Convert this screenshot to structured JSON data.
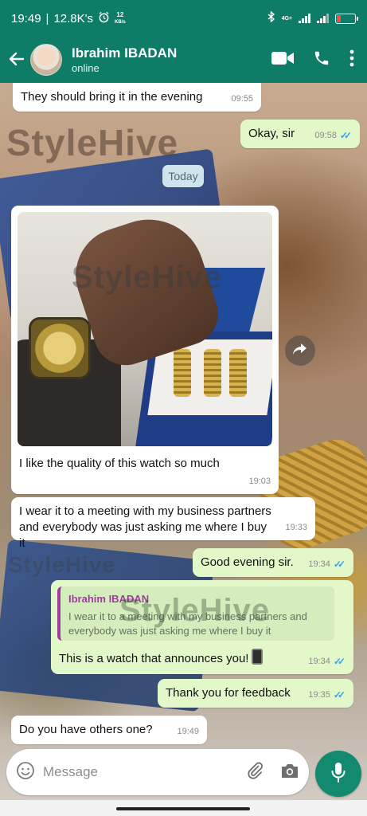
{
  "status_bar": {
    "time": "19:49",
    "net_speed": "12.8K's",
    "speed_num": "12",
    "speed_unit": "KB/s",
    "network_label": "4G+"
  },
  "header": {
    "contact_name": "Ibrahim IBADAN",
    "contact_status": "online"
  },
  "watermark": "StyleHive",
  "date_divider": "Today",
  "messages": [
    {
      "text": "They should bring it in the evening",
      "time": "09:55",
      "direction": "incoming"
    },
    {
      "text": "Okay, sir",
      "time": "09:58",
      "direction": "outgoing",
      "read": true
    },
    {
      "text": "I like the quality of this watch so much",
      "time": "19:03",
      "direction": "incoming",
      "has_image": true
    },
    {
      "text": "I wear it to a meeting with my business partners and everybody was just asking me where I buy it",
      "time": "19:33",
      "direction": "incoming"
    },
    {
      "text": "Good evening sir.",
      "time": "19:34",
      "direction": "outgoing",
      "read": true
    },
    {
      "quote_name": "Ibrahim IBADAN",
      "quote_text": "I wear it to a meeting with my business partners and everybody was just asking me where I buy it",
      "text": "This is a watch that announces you!",
      "time": "19:34",
      "direction": "outgoing",
      "read": true
    },
    {
      "text": "Thank you for feedback",
      "time": "19:35",
      "direction": "outgoing",
      "read": true
    },
    {
      "text": "Do you have others one?",
      "time": "19:49",
      "direction": "incoming"
    }
  ],
  "composer": {
    "placeholder": "Message"
  },
  "colors": {
    "header": "#0e7c67",
    "outgoing_bubble": "#e2f8c9",
    "incoming_bubble": "#ffffff",
    "read_ticks": "#3ea0e8",
    "mic_button": "#138a6f",
    "quote_accent": "#a23a9f"
  },
  "icons": [
    "back-arrow-icon",
    "video-call-icon",
    "phone-icon",
    "more-vert-icon",
    "forward-icon",
    "emoji-icon",
    "attach-icon",
    "camera-icon",
    "mic-icon",
    "read-ticks-icon",
    "alarm-icon",
    "bluetooth-icon",
    "signal-icon",
    "battery-icon"
  ]
}
